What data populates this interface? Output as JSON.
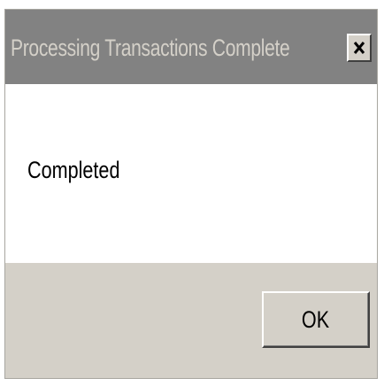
{
  "dialog": {
    "title": "Processing Transactions Complete",
    "close_icon": "close-x-icon",
    "message": "Completed",
    "ok_label": "OK"
  },
  "colors": {
    "titlebar_inactive": "#828282",
    "title_text": "#d4d0c8",
    "face": "#d4d0c8",
    "content_bg": "#ffffff"
  }
}
